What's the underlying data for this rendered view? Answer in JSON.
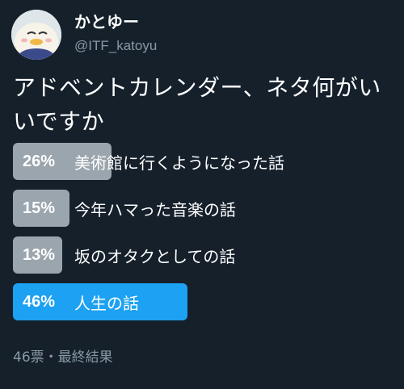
{
  "user": {
    "display_name": "かとゆー",
    "handle": "@ITF_katoyu",
    "avatar_icon": "bird-avatar-icon"
  },
  "tweet": {
    "text": "アドベントカレンダー、ネタ何がいいですか"
  },
  "poll": {
    "options": [
      {
        "percent": "26%",
        "label": "美術館に行くようになった話",
        "value": 26,
        "winner": false
      },
      {
        "percent": "15%",
        "label": "今年ハマった音楽の話",
        "value": 15,
        "winner": false
      },
      {
        "percent": "13%",
        "label": "坂のオタクとしての話",
        "value": 13,
        "winner": false
      },
      {
        "percent": "46%",
        "label": "人生の話",
        "value": 46,
        "winner": true
      }
    ],
    "footer": "46票・最終結果"
  },
  "colors": {
    "background": "#15202b",
    "bar": "#9aa5ae",
    "winner_bar": "#1da1f2",
    "secondary_text": "#8899a6"
  }
}
